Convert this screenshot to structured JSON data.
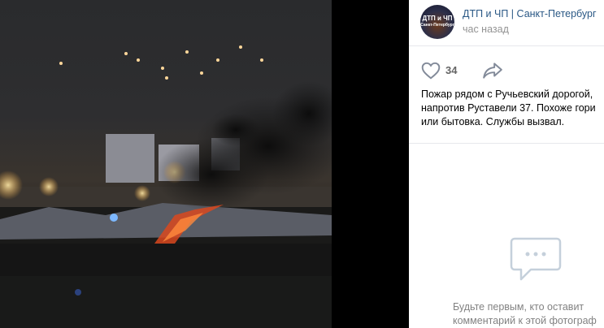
{
  "post": {
    "group_name": "ДТП и ЧП | Санкт-Петербург",
    "time": "час назад",
    "avatar_text_top": "ДТП и ЧП",
    "avatar_text_bottom": "Санкт-Петербург",
    "likes": "34",
    "text_lines": [
      "Пожар рядом с Ручьевский дорогой,",
      "напротив Руставели 37. Похоже гори",
      "или бытовка. Службы вызвал."
    ]
  },
  "comments": {
    "empty_lines": [
      "Будьте первым, кто оставит",
      "комментарий к этой фотограф"
    ]
  },
  "icons": {
    "like": "heart-icon",
    "share": "share-arrow-icon",
    "comments": "comment-bubble-icon"
  },
  "colors": {
    "link": "#2a5885",
    "muted": "#939393",
    "icon": "#828a99"
  }
}
